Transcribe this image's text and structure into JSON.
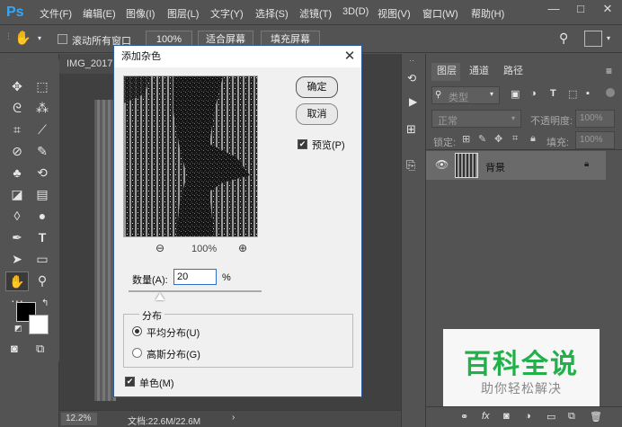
{
  "app": {
    "logo": "Ps"
  },
  "menu": [
    "文件(F)",
    "编辑(E)",
    "图像(I)",
    "图层(L)",
    "文字(Y)",
    "选择(S)",
    "滤镜(T)",
    "3D(D)",
    "视图(V)",
    "窗口(W)",
    "帮助(H)"
  ],
  "window_controls": {
    "minimize": "—",
    "restore": "□",
    "close": "✕"
  },
  "options": {
    "scroll_all": "滚动所有窗口",
    "zoom": "100%",
    "fit_screen": "适合屏幕",
    "fill_screen": "填充屏幕"
  },
  "document": {
    "tab": "IMG_2017(",
    "zoom": "12.2%",
    "doc_info": "文档:22.6M/22.6M"
  },
  "panels": {
    "tabs": [
      "图层",
      "通道",
      "路径"
    ],
    "filter": "类型",
    "blend": "正常",
    "opacity_label": "不透明度:",
    "opacity": "100%",
    "lock_label": "锁定:",
    "fill_label": "填充:",
    "fill": "100%",
    "layer_name": "背景"
  },
  "dialog": {
    "title": "添加杂色",
    "ok": "确定",
    "cancel": "取消",
    "preview": "预览(P)",
    "zoom": "100%",
    "amount_label": "数量(A):",
    "amount": "20",
    "percent": "%",
    "distribution": "分布",
    "uniform": "平均分布(U)",
    "gaussian": "高斯分布(G)",
    "mono": "单色(M)"
  },
  "watermark": {
    "title": "百科全说",
    "subtitle": "助你轻松解决"
  },
  "colors": {
    "accent": "#31a8ff",
    "watermark_green": "#22b04a",
    "dialog_border": "#2f5d9e"
  }
}
